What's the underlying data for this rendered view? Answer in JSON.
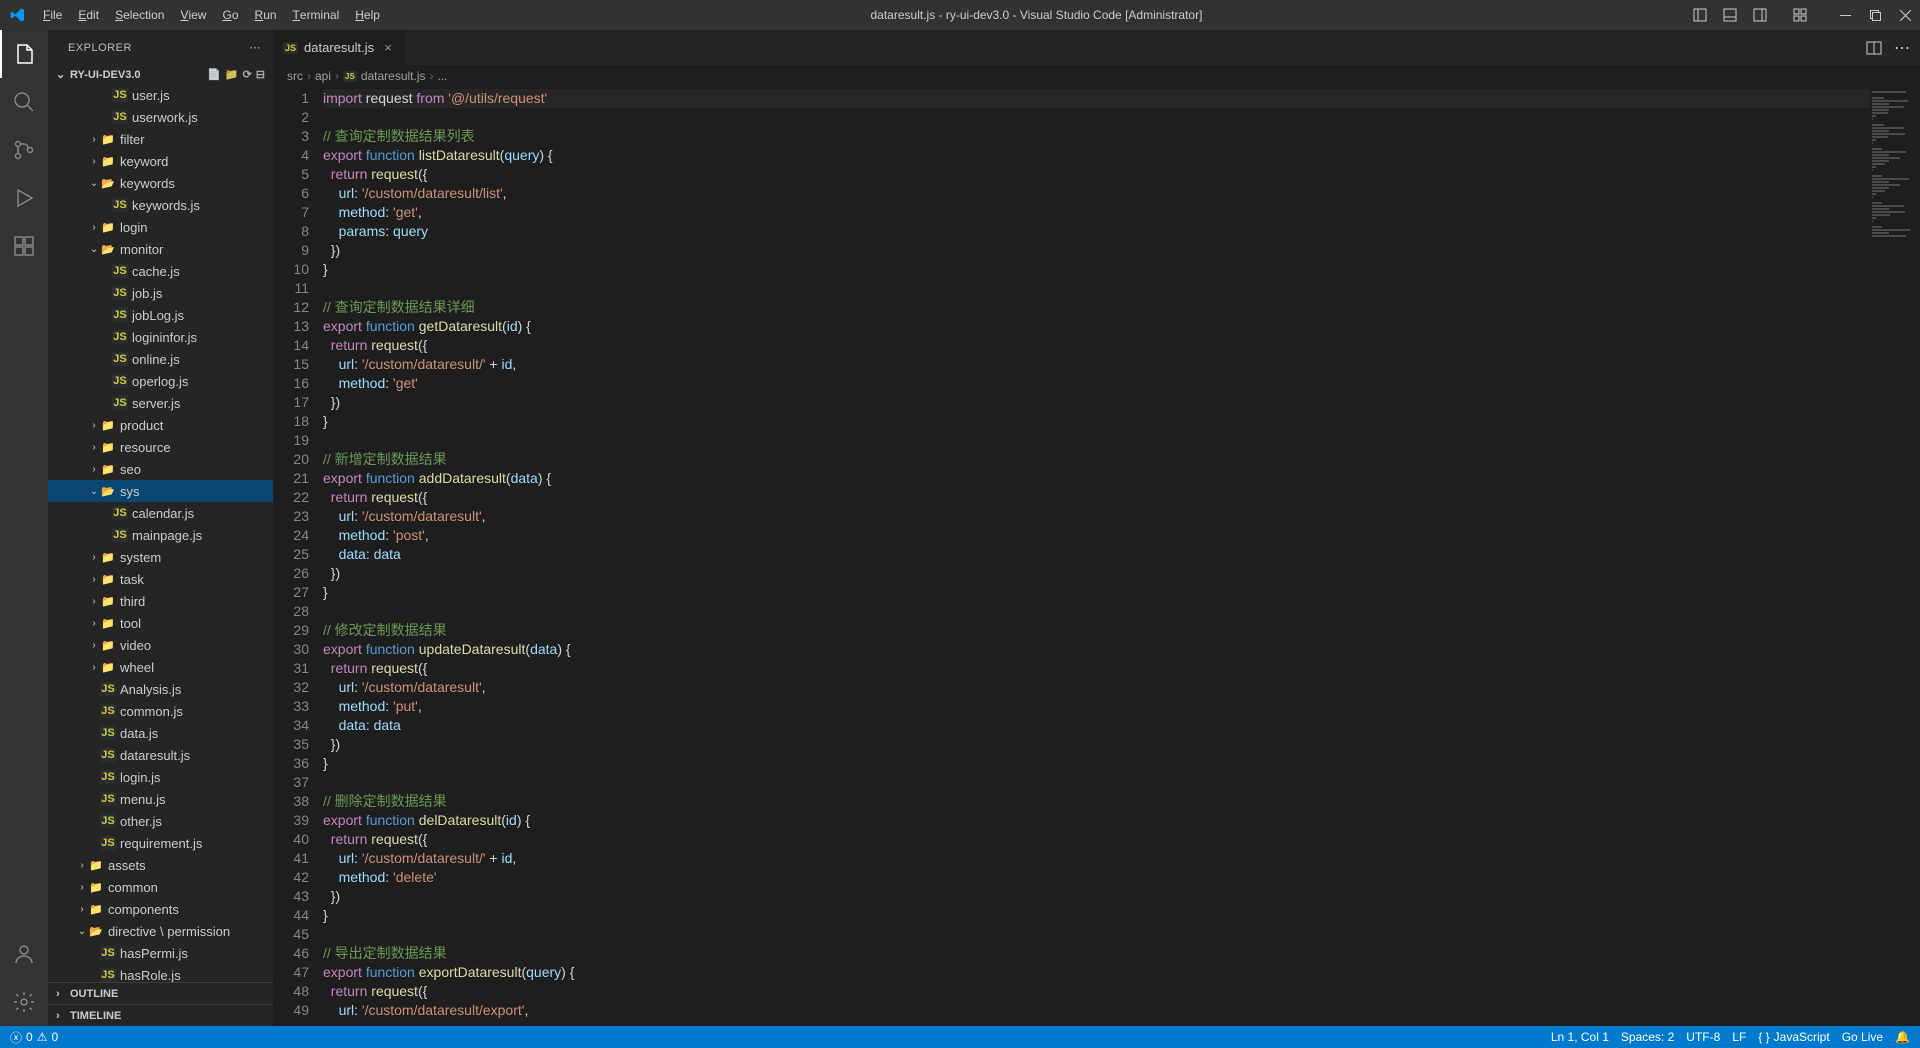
{
  "window": {
    "title": "dataresult.js - ry-ui-dev3.0 - Visual Studio Code [Administrator]"
  },
  "menus": [
    "File",
    "Edit",
    "Selection",
    "View",
    "Go",
    "Run",
    "Terminal",
    "Help"
  ],
  "sidebar": {
    "title": "EXPLORER",
    "project": "RY-UI-DEV3.0",
    "outline": "OUTLINE",
    "timeline": "TIMELINE"
  },
  "tree": [
    {
      "depth": 4,
      "type": "file",
      "icon": "js",
      "label": "user.js"
    },
    {
      "depth": 4,
      "type": "file",
      "icon": "js",
      "label": "userwork.js"
    },
    {
      "depth": 3,
      "type": "folder",
      "open": false,
      "label": "filter"
    },
    {
      "depth": 3,
      "type": "folder",
      "open": false,
      "label": "keyword"
    },
    {
      "depth": 3,
      "type": "folder",
      "open": true,
      "label": "keywords"
    },
    {
      "depth": 4,
      "type": "file",
      "icon": "js",
      "label": "keywords.js"
    },
    {
      "depth": 3,
      "type": "folder",
      "open": false,
      "label": "login"
    },
    {
      "depth": 3,
      "type": "folder",
      "open": true,
      "label": "monitor"
    },
    {
      "depth": 4,
      "type": "file",
      "icon": "js",
      "label": "cache.js"
    },
    {
      "depth": 4,
      "type": "file",
      "icon": "js",
      "label": "job.js"
    },
    {
      "depth": 4,
      "type": "file",
      "icon": "js",
      "label": "jobLog.js"
    },
    {
      "depth": 4,
      "type": "file",
      "icon": "js",
      "label": "logininfor.js"
    },
    {
      "depth": 4,
      "type": "file",
      "icon": "js",
      "label": "online.js"
    },
    {
      "depth": 4,
      "type": "file",
      "icon": "js",
      "label": "operlog.js"
    },
    {
      "depth": 4,
      "type": "file",
      "icon": "js",
      "label": "server.js"
    },
    {
      "depth": 3,
      "type": "folder",
      "open": false,
      "label": "product"
    },
    {
      "depth": 3,
      "type": "folder",
      "open": false,
      "label": "resource"
    },
    {
      "depth": 3,
      "type": "folder",
      "open": false,
      "label": "seo"
    },
    {
      "depth": 3,
      "type": "folder",
      "open": true,
      "label": "sys",
      "selected": true
    },
    {
      "depth": 4,
      "type": "file",
      "icon": "js",
      "label": "calendar.js"
    },
    {
      "depth": 4,
      "type": "file",
      "icon": "js",
      "label": "mainpage.js"
    },
    {
      "depth": 3,
      "type": "folder",
      "open": false,
      "label": "system"
    },
    {
      "depth": 3,
      "type": "folder",
      "open": false,
      "label": "task"
    },
    {
      "depth": 3,
      "type": "folder",
      "open": false,
      "label": "third"
    },
    {
      "depth": 3,
      "type": "folder",
      "open": false,
      "label": "tool",
      "iconColor": "#e06c75"
    },
    {
      "depth": 3,
      "type": "folder",
      "open": false,
      "label": "video"
    },
    {
      "depth": 3,
      "type": "folder",
      "open": false,
      "label": "wheel"
    },
    {
      "depth": 3,
      "type": "file",
      "icon": "js",
      "label": "Analysis.js"
    },
    {
      "depth": 3,
      "type": "file",
      "icon": "js",
      "label": "common.js"
    },
    {
      "depth": 3,
      "type": "file",
      "icon": "js",
      "label": "data.js"
    },
    {
      "depth": 3,
      "type": "file",
      "icon": "js",
      "label": "dataresult.js"
    },
    {
      "depth": 3,
      "type": "file",
      "icon": "js",
      "label": "login.js"
    },
    {
      "depth": 3,
      "type": "file",
      "icon": "js",
      "label": "menu.js"
    },
    {
      "depth": 3,
      "type": "file",
      "icon": "js",
      "label": "other.js"
    },
    {
      "depth": 3,
      "type": "file",
      "icon": "js",
      "label": "requirement.js"
    },
    {
      "depth": 2,
      "type": "folder",
      "open": false,
      "label": "assets",
      "iconColor": "#888"
    },
    {
      "depth": 2,
      "type": "folder",
      "open": false,
      "label": "common"
    },
    {
      "depth": 2,
      "type": "folder",
      "open": false,
      "label": "components"
    },
    {
      "depth": 2,
      "type": "folder",
      "open": true,
      "label": "directive \\ permission"
    },
    {
      "depth": 3,
      "type": "file",
      "icon": "js",
      "label": "hasPermi.js"
    },
    {
      "depth": 3,
      "type": "file",
      "icon": "js",
      "label": "hasRole.js"
    }
  ],
  "tab": {
    "label": "dataresult.js"
  },
  "breadcrumb": [
    "src",
    "api",
    "dataresult.js",
    "..."
  ],
  "code_lines": [
    {
      "n": 1,
      "hl": true,
      "tokens": [
        [
          "kw",
          "import"
        ],
        [
          "pn",
          " request "
        ],
        [
          "kw",
          "from"
        ],
        [
          "pn",
          " "
        ],
        [
          "str",
          "'@/utils/request'"
        ]
      ]
    },
    {
      "n": 2,
      "tokens": []
    },
    {
      "n": 3,
      "tokens": [
        [
          "cm",
          "// 查询定制数据结果列表"
        ]
      ]
    },
    {
      "n": 4,
      "tokens": [
        [
          "kw",
          "export"
        ],
        [
          "pn",
          " "
        ],
        [
          "kw2",
          "function"
        ],
        [
          "pn",
          " "
        ],
        [
          "fn",
          "listDataresult"
        ],
        [
          "pn",
          "("
        ],
        [
          "var",
          "query"
        ],
        [
          "pn",
          ") {"
        ]
      ]
    },
    {
      "n": 5,
      "tokens": [
        [
          "pn",
          "  "
        ],
        [
          "kw",
          "return"
        ],
        [
          "pn",
          " "
        ],
        [
          "fn",
          "request"
        ],
        [
          "pn",
          "({"
        ]
      ]
    },
    {
      "n": 6,
      "tokens": [
        [
          "pn",
          "    "
        ],
        [
          "var",
          "url"
        ],
        [
          "pn",
          ": "
        ],
        [
          "str",
          "'/custom/dataresult/list'"
        ],
        [
          "pn",
          ","
        ]
      ]
    },
    {
      "n": 7,
      "tokens": [
        [
          "pn",
          "    "
        ],
        [
          "var",
          "method"
        ],
        [
          "pn",
          ": "
        ],
        [
          "str",
          "'get'"
        ],
        [
          "pn",
          ","
        ]
      ]
    },
    {
      "n": 8,
      "tokens": [
        [
          "pn",
          "    "
        ],
        [
          "var",
          "params"
        ],
        [
          "pn",
          ": "
        ],
        [
          "var",
          "query"
        ]
      ]
    },
    {
      "n": 9,
      "tokens": [
        [
          "pn",
          "  })"
        ]
      ]
    },
    {
      "n": 10,
      "tokens": [
        [
          "pn",
          "}"
        ]
      ]
    },
    {
      "n": 11,
      "tokens": []
    },
    {
      "n": 12,
      "tokens": [
        [
          "cm",
          "// 查询定制数据结果详细"
        ]
      ]
    },
    {
      "n": 13,
      "tokens": [
        [
          "kw",
          "export"
        ],
        [
          "pn",
          " "
        ],
        [
          "kw2",
          "function"
        ],
        [
          "pn",
          " "
        ],
        [
          "fn",
          "getDataresult"
        ],
        [
          "pn",
          "("
        ],
        [
          "var",
          "id"
        ],
        [
          "pn",
          ") {"
        ]
      ]
    },
    {
      "n": 14,
      "tokens": [
        [
          "pn",
          "  "
        ],
        [
          "kw",
          "return"
        ],
        [
          "pn",
          " "
        ],
        [
          "fn",
          "request"
        ],
        [
          "pn",
          "({"
        ]
      ]
    },
    {
      "n": 15,
      "tokens": [
        [
          "pn",
          "    "
        ],
        [
          "var",
          "url"
        ],
        [
          "pn",
          ": "
        ],
        [
          "str",
          "'/custom/dataresult/'"
        ],
        [
          "pn",
          " + "
        ],
        [
          "var",
          "id"
        ],
        [
          "pn",
          ","
        ]
      ]
    },
    {
      "n": 16,
      "tokens": [
        [
          "pn",
          "    "
        ],
        [
          "var",
          "method"
        ],
        [
          "pn",
          ": "
        ],
        [
          "str",
          "'get'"
        ]
      ]
    },
    {
      "n": 17,
      "tokens": [
        [
          "pn",
          "  })"
        ]
      ]
    },
    {
      "n": 18,
      "tokens": [
        [
          "pn",
          "}"
        ]
      ]
    },
    {
      "n": 19,
      "tokens": []
    },
    {
      "n": 20,
      "tokens": [
        [
          "cm",
          "// 新增定制数据结果"
        ]
      ]
    },
    {
      "n": 21,
      "tokens": [
        [
          "kw",
          "export"
        ],
        [
          "pn",
          " "
        ],
        [
          "kw2",
          "function"
        ],
        [
          "pn",
          " "
        ],
        [
          "fn",
          "addDataresult"
        ],
        [
          "pn",
          "("
        ],
        [
          "var",
          "data"
        ],
        [
          "pn",
          ") {"
        ]
      ]
    },
    {
      "n": 22,
      "tokens": [
        [
          "pn",
          "  "
        ],
        [
          "kw",
          "return"
        ],
        [
          "pn",
          " "
        ],
        [
          "fn",
          "request"
        ],
        [
          "pn",
          "({"
        ]
      ]
    },
    {
      "n": 23,
      "tokens": [
        [
          "pn",
          "    "
        ],
        [
          "var",
          "url"
        ],
        [
          "pn",
          ": "
        ],
        [
          "str",
          "'/custom/dataresult'"
        ],
        [
          "pn",
          ","
        ]
      ]
    },
    {
      "n": 24,
      "tokens": [
        [
          "pn",
          "    "
        ],
        [
          "var",
          "method"
        ],
        [
          "pn",
          ": "
        ],
        [
          "str",
          "'post'"
        ],
        [
          "pn",
          ","
        ]
      ]
    },
    {
      "n": 25,
      "tokens": [
        [
          "pn",
          "    "
        ],
        [
          "var",
          "data"
        ],
        [
          "pn",
          ": "
        ],
        [
          "var",
          "data"
        ]
      ]
    },
    {
      "n": 26,
      "tokens": [
        [
          "pn",
          "  })"
        ]
      ]
    },
    {
      "n": 27,
      "tokens": [
        [
          "pn",
          "}"
        ]
      ]
    },
    {
      "n": 28,
      "tokens": []
    },
    {
      "n": 29,
      "tokens": [
        [
          "cm",
          "// 修改定制数据结果"
        ]
      ]
    },
    {
      "n": 30,
      "tokens": [
        [
          "kw",
          "export"
        ],
        [
          "pn",
          " "
        ],
        [
          "kw2",
          "function"
        ],
        [
          "pn",
          " "
        ],
        [
          "fn",
          "updateDataresult"
        ],
        [
          "pn",
          "("
        ],
        [
          "var",
          "data"
        ],
        [
          "pn",
          ") {"
        ]
      ]
    },
    {
      "n": 31,
      "tokens": [
        [
          "pn",
          "  "
        ],
        [
          "kw",
          "return"
        ],
        [
          "pn",
          " "
        ],
        [
          "fn",
          "request"
        ],
        [
          "pn",
          "({"
        ]
      ]
    },
    {
      "n": 32,
      "tokens": [
        [
          "pn",
          "    "
        ],
        [
          "var",
          "url"
        ],
        [
          "pn",
          ": "
        ],
        [
          "str",
          "'/custom/dataresult'"
        ],
        [
          "pn",
          ","
        ]
      ]
    },
    {
      "n": 33,
      "tokens": [
        [
          "pn",
          "    "
        ],
        [
          "var",
          "method"
        ],
        [
          "pn",
          ": "
        ],
        [
          "str",
          "'put'"
        ],
        [
          "pn",
          ","
        ]
      ]
    },
    {
      "n": 34,
      "tokens": [
        [
          "pn",
          "    "
        ],
        [
          "var",
          "data"
        ],
        [
          "pn",
          ": "
        ],
        [
          "var",
          "data"
        ]
      ]
    },
    {
      "n": 35,
      "tokens": [
        [
          "pn",
          "  })"
        ]
      ]
    },
    {
      "n": 36,
      "tokens": [
        [
          "pn",
          "}"
        ]
      ]
    },
    {
      "n": 37,
      "tokens": []
    },
    {
      "n": 38,
      "tokens": [
        [
          "cm",
          "// 删除定制数据结果"
        ]
      ]
    },
    {
      "n": 39,
      "tokens": [
        [
          "kw",
          "export"
        ],
        [
          "pn",
          " "
        ],
        [
          "kw2",
          "function"
        ],
        [
          "pn",
          " "
        ],
        [
          "fn",
          "delDataresult"
        ],
        [
          "pn",
          "("
        ],
        [
          "var",
          "id"
        ],
        [
          "pn",
          ") {"
        ]
      ]
    },
    {
      "n": 40,
      "tokens": [
        [
          "pn",
          "  "
        ],
        [
          "kw",
          "return"
        ],
        [
          "pn",
          " "
        ],
        [
          "fn",
          "request"
        ],
        [
          "pn",
          "({"
        ]
      ]
    },
    {
      "n": 41,
      "tokens": [
        [
          "pn",
          "    "
        ],
        [
          "var",
          "url"
        ],
        [
          "pn",
          ": "
        ],
        [
          "str",
          "'/custom/dataresult/'"
        ],
        [
          "pn",
          " + "
        ],
        [
          "var",
          "id"
        ],
        [
          "pn",
          ","
        ]
      ]
    },
    {
      "n": 42,
      "tokens": [
        [
          "pn",
          "    "
        ],
        [
          "var",
          "method"
        ],
        [
          "pn",
          ": "
        ],
        [
          "str",
          "'delete'"
        ]
      ]
    },
    {
      "n": 43,
      "tokens": [
        [
          "pn",
          "  })"
        ]
      ]
    },
    {
      "n": 44,
      "tokens": [
        [
          "pn",
          "}"
        ]
      ]
    },
    {
      "n": 45,
      "tokens": []
    },
    {
      "n": 46,
      "tokens": [
        [
          "cm",
          "// 导出定制数据结果"
        ]
      ]
    },
    {
      "n": 47,
      "tokens": [
        [
          "kw",
          "export"
        ],
        [
          "pn",
          " "
        ],
        [
          "kw2",
          "function"
        ],
        [
          "pn",
          " "
        ],
        [
          "fn",
          "exportDataresult"
        ],
        [
          "pn",
          "("
        ],
        [
          "var",
          "query"
        ],
        [
          "pn",
          ") {"
        ]
      ]
    },
    {
      "n": 48,
      "tokens": [
        [
          "pn",
          "  "
        ],
        [
          "kw",
          "return"
        ],
        [
          "pn",
          " "
        ],
        [
          "fn",
          "request"
        ],
        [
          "pn",
          "({"
        ]
      ]
    },
    {
      "n": 49,
      "tokens": [
        [
          "pn",
          "    "
        ],
        [
          "var",
          "url"
        ],
        [
          "pn",
          ": "
        ],
        [
          "str",
          "'/custom/dataresult/export'"
        ],
        [
          "pn",
          ","
        ]
      ]
    }
  ],
  "statusbar": {
    "errors": "0",
    "warnings": "0",
    "position": "Ln 1, Col 1",
    "spaces": "Spaces: 2",
    "encoding": "UTF-8",
    "eol": "LF",
    "language": "JavaScript",
    "feedback": "Go Live",
    "bell": "🔔"
  }
}
